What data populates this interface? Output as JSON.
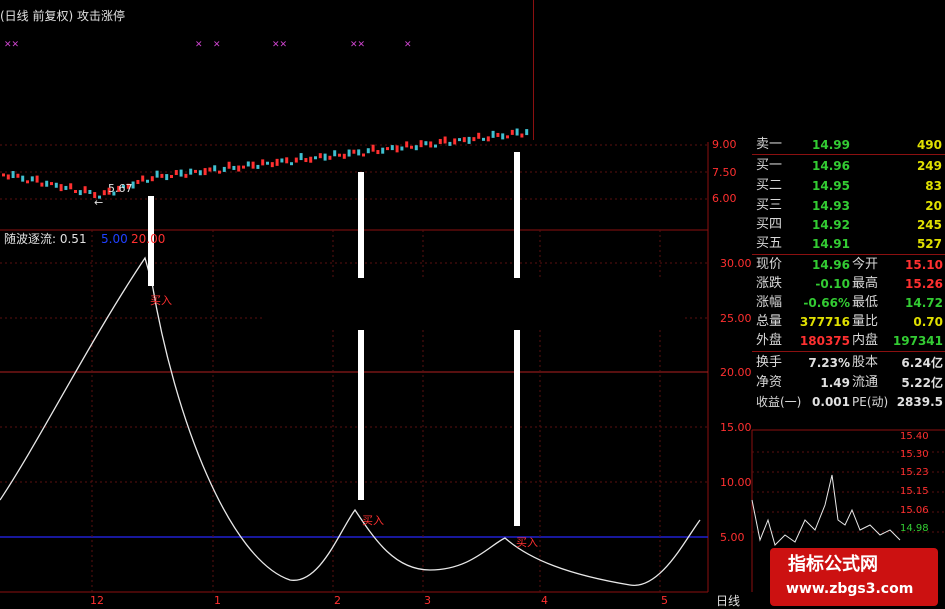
{
  "header": {
    "title": "(日线 前复权) 攻击涨停"
  },
  "price_axis": [
    "9.00",
    "7.50",
    "6.00"
  ],
  "indicator": {
    "name": "随波逐流: 0.51",
    "param1": "5.00",
    "param2": "20.00",
    "axis": [
      "30.00",
      "25.00",
      "20.00",
      "15.00",
      "10.00",
      "5.00"
    ],
    "buy_label": "买入"
  },
  "price_annotation": "5.67",
  "date_axis": [
    "12",
    "1",
    "2",
    "3",
    "4",
    "5"
  ],
  "period_label": "日线",
  "quote": {
    "sell": [
      {
        "label": "卖一",
        "price": "14.99",
        "vol": "490"
      }
    ],
    "buy": [
      {
        "label": "买一",
        "price": "14.96",
        "vol": "249"
      },
      {
        "label": "买二",
        "price": "14.95",
        "vol": "83"
      },
      {
        "label": "买三",
        "price": "14.93",
        "vol": "20"
      },
      {
        "label": "买四",
        "price": "14.92",
        "vol": "245"
      },
      {
        "label": "买五",
        "price": "14.91",
        "vol": "527"
      }
    ],
    "stats": [
      {
        "l1": "现价",
        "v1": "14.96",
        "l2": "今开",
        "v2": "15.10"
      },
      {
        "l1": "涨跌",
        "v1": "-0.10",
        "l2": "最高",
        "v2": "15.26"
      },
      {
        "l1": "涨幅",
        "v1": "-0.66%",
        "l2": "最低",
        "v2": "14.72"
      },
      {
        "l1": "总量",
        "v1": "377716",
        "l2": "量比",
        "v2": "0.70"
      },
      {
        "l1": "外盘",
        "v1": "180375",
        "l2": "内盘",
        "v2": "197341"
      },
      {
        "l1": "换手",
        "v1": "7.23%",
        "l2": "股本",
        "v2": "6.24亿"
      },
      {
        "l1": "净资",
        "v1": "1.49",
        "l2": "流通",
        "v2": "5.22亿"
      },
      {
        "l1": "收益(一)",
        "v1": "0.001",
        "l2": "PE(动)",
        "v2": "2839.5"
      }
    ]
  },
  "mini_axis": [
    "15.40",
    "15.30",
    "15.23",
    "15.15",
    "15.06",
    "14.98"
  ],
  "watermark": {
    "line1": "指标公式网",
    "line2": "www.zbgs3.com"
  }
}
